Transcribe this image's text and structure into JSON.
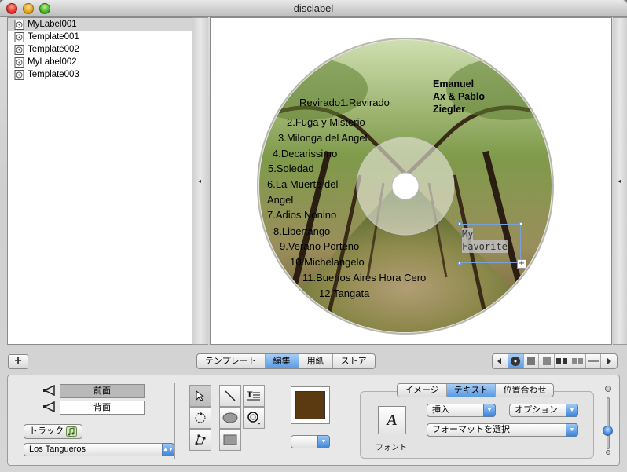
{
  "window": {
    "title": "disclabel"
  },
  "sidebar": {
    "items": [
      {
        "label": "MyLabel001",
        "selected": true
      },
      {
        "label": "Template001",
        "selected": false
      },
      {
        "label": "Template002",
        "selected": false
      },
      {
        "label": "MyLabel002",
        "selected": false
      },
      {
        "label": "Template003",
        "selected": false
      }
    ]
  },
  "disc": {
    "artist": [
      "Emanuel",
      "Ax & Pablo",
      "Ziegler"
    ],
    "tracks": [
      "Revirado1.Revirado",
      "2.Fuga y Misterio",
      "3.Milonga del Angel",
      "4.Decarissimo",
      "5.Soledad",
      "6.La Muerte del",
      "Angel",
      "7.Adios Nonino",
      "8.Libertango",
      "9.Verano Porteno",
      "10.Michelangelo",
      "11.Buenos Aires Hora Cero",
      "12.Tangata"
    ],
    "textbox": [
      "My",
      "Favorite"
    ]
  },
  "toolbar": {
    "tabs": [
      {
        "label": "テンプレート",
        "active": false
      },
      {
        "label": "編集",
        "active": true
      },
      {
        "label": "用紙",
        "active": false
      },
      {
        "label": "ストア",
        "active": false
      }
    ]
  },
  "panel": {
    "front_label": "前面",
    "back_label": "背面",
    "track_button": "トラック",
    "album_select": "Los Tangueros",
    "fill_color": "#5b3a12",
    "inspector_tabs": [
      {
        "label": "イメージ",
        "active": false
      },
      {
        "label": "テキスト",
        "active": true
      },
      {
        "label": "位置合わせ",
        "active": false
      }
    ],
    "insert_label": "挿入",
    "options_label": "オプション",
    "format_label": "フォーマットを選択",
    "font_button": "A",
    "font_label": "フォント"
  }
}
